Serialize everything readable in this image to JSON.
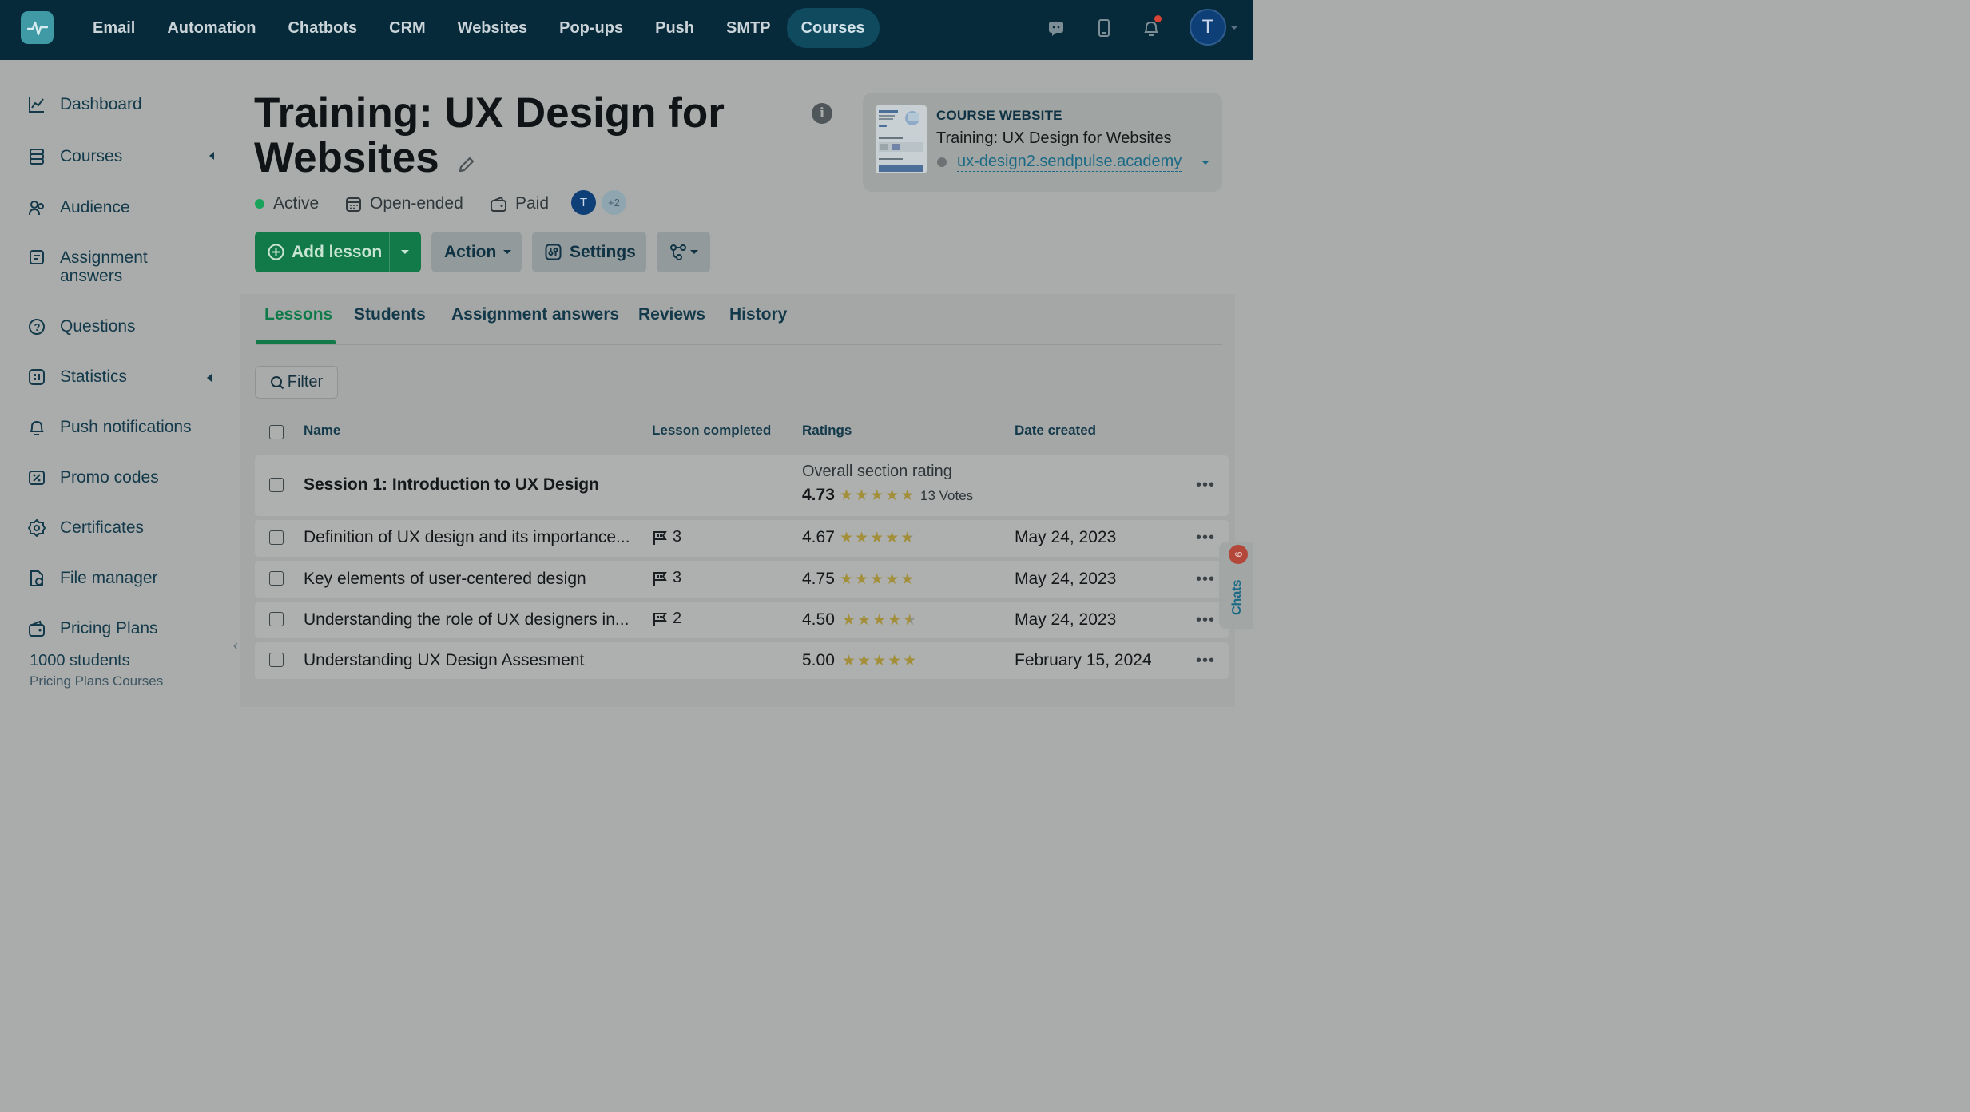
{
  "topnav": {
    "items": [
      {
        "label": "Email"
      },
      {
        "label": "Automation"
      },
      {
        "label": "Chatbots"
      },
      {
        "label": "CRM"
      },
      {
        "label": "Websites"
      },
      {
        "label": "Pop-ups"
      },
      {
        "label": "Push"
      },
      {
        "label": "SMTP"
      },
      {
        "label": "Courses"
      }
    ],
    "active": "Courses",
    "user_initial": "T",
    "icons": [
      "chat-icon",
      "mobile-icon",
      "bell-icon"
    ]
  },
  "sidebar": {
    "items": [
      {
        "label": "Dashboard",
        "icon": "chart-line-icon"
      },
      {
        "label": "Courses",
        "icon": "courses-icon"
      },
      {
        "label": "Audience",
        "icon": "audience-icon"
      },
      {
        "label": "Assignment answers",
        "icon": "assignment-icon"
      },
      {
        "label": "Questions",
        "icon": "question-icon"
      },
      {
        "label": "Statistics",
        "icon": "statistics-icon"
      },
      {
        "label": "Push notifications",
        "icon": "bell-icon"
      },
      {
        "label": "Promo codes",
        "icon": "promo-icon"
      },
      {
        "label": "Certificates",
        "icon": "certificate-icon"
      },
      {
        "label": "File manager",
        "icon": "file-manager-icon"
      },
      {
        "label": "Pricing Plans",
        "icon": "wallet-icon"
      }
    ],
    "plan": {
      "title": "1000 students",
      "subtitle": "Pricing Plans Courses"
    }
  },
  "course": {
    "title": "Training: UX Design for Websites",
    "status": "Active",
    "duration": "Open-ended",
    "price_type": "Paid",
    "team_avatar": "T",
    "team_more": "+2"
  },
  "toolbar": {
    "add_lesson": "Add lesson",
    "action": "Action",
    "settings": "Settings"
  },
  "course_website": {
    "label": "COURSE WEBSITE",
    "title": "Training: UX Design for Websites",
    "link": "ux-design2.sendpulse.academy"
  },
  "tabs": [
    {
      "label": "Lessons"
    },
    {
      "label": "Students"
    },
    {
      "label": "Assignment answers"
    },
    {
      "label": "Reviews"
    },
    {
      "label": "History"
    }
  ],
  "active_tab": "Lessons",
  "filter_label": "Filter",
  "table": {
    "columns": [
      "Name",
      "Lesson completed",
      "Ratings",
      "Date created"
    ],
    "section": {
      "name": "Session 1: Introduction to UX Design",
      "rating_label": "Overall section rating",
      "rating": "4.73",
      "rating_value": 4.73,
      "votes": "13 Votes"
    },
    "rows": [
      {
        "name": "Definition of UX design and its importance...",
        "completed": "3",
        "rating": "4.67",
        "rating_value": 4.67,
        "date": "May 24, 2023"
      },
      {
        "name": "Key elements of user-centered design",
        "completed": "3",
        "rating": "4.75",
        "rating_value": 4.75,
        "date": "May 24, 2023"
      },
      {
        "name": "Understanding the role of UX designers in...",
        "completed": "2",
        "rating": "4.50",
        "rating_value": 4.5,
        "date": "May 24, 2023"
      },
      {
        "name": "Understanding UX Design Assesment",
        "completed": "",
        "rating": "5.00",
        "rating_value": 5.0,
        "date": "February 15, 2024"
      }
    ]
  },
  "chats": {
    "label": "Chats",
    "count": "6"
  },
  "colors": {
    "topbar": "#062a3a",
    "primary": "#117a48",
    "link": "#1a6a86",
    "star": "#a38f3a"
  }
}
